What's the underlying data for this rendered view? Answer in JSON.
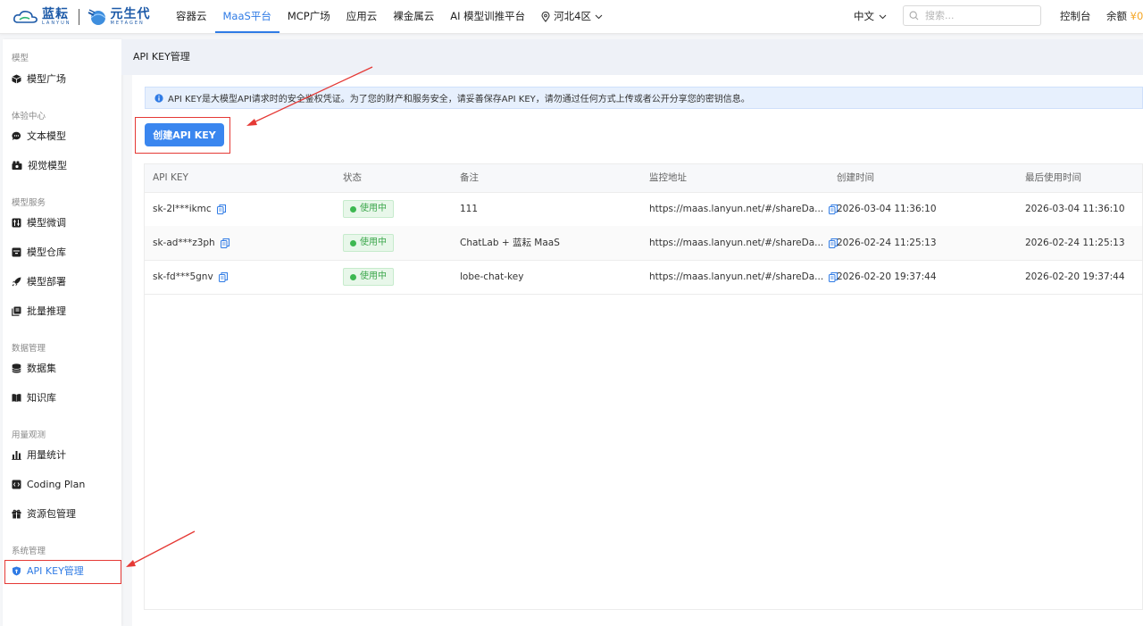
{
  "header": {
    "logo1_text": "蓝耘",
    "logo1_sub": "LANYUN",
    "logo2_text": "元生代",
    "logo2_sub": "METAGEN",
    "nav": [
      "容器云",
      "MaaS平台",
      "MCP广场",
      "应用云",
      "裸金属云",
      "AI 模型训推平台"
    ],
    "active_nav": "MaaS平台",
    "region": "河北4区",
    "language": "中文",
    "search_placeholder": "搜索...",
    "console": "控制台",
    "balance_label": "余额",
    "balance_value": "¥0"
  },
  "sidebar": {
    "sections": [
      {
        "title": "模型",
        "items": [
          {
            "label": "模型广场",
            "icon": "cube-icon"
          }
        ]
      },
      {
        "title": "体验中心",
        "items": [
          {
            "label": "文本模型",
            "icon": "chat-bubble-icon"
          },
          {
            "label": "视觉模型",
            "icon": "vision-icon"
          }
        ]
      },
      {
        "title": "模型服务",
        "items": [
          {
            "label": "模型微调",
            "icon": "tune-icon"
          },
          {
            "label": "模型仓库",
            "icon": "archive-icon"
          },
          {
            "label": "模型部署",
            "icon": "rocket-icon"
          },
          {
            "label": "批量推理",
            "icon": "batch-icon"
          }
        ]
      },
      {
        "title": "数据管理",
        "items": [
          {
            "label": "数据集",
            "icon": "database-icon"
          },
          {
            "label": "知识库",
            "icon": "book-icon"
          }
        ]
      },
      {
        "title": "用量观测",
        "items": [
          {
            "label": "用量统计",
            "icon": "bar-chart-icon"
          },
          {
            "label": "Coding Plan",
            "icon": "code-icon"
          },
          {
            "label": "资源包管理",
            "icon": "gift-icon"
          }
        ]
      },
      {
        "title": "系统管理",
        "items": [
          {
            "label": "API KEY管理",
            "icon": "shield-icon"
          }
        ]
      }
    ],
    "active_item": "API KEY管理"
  },
  "page": {
    "title": "API KEY管理",
    "info": "API KEY是大模型API请求时的安全鉴权凭证。为了您的财产和服务安全，请妥善保存API KEY，请勿通过任何方式上传或者公开分享您的密钥信息。",
    "create_button": "创建API KEY"
  },
  "table": {
    "columns": [
      "API KEY",
      "状态",
      "备注",
      "监控地址",
      "创建时间",
      "最后使用时间"
    ],
    "rows": [
      {
        "key": "sk-2l***ikmc",
        "status": "使用中",
        "note": "111",
        "monitor": "https://maas.lanyun.net/#/shareDa...",
        "created": "2026-03-04 11:36:10",
        "last_used": "2026-03-04 11:36:10"
      },
      {
        "key": "sk-ad***z3ph",
        "status": "使用中",
        "note": "ChatLab + 蓝耘 MaaS",
        "monitor": "https://maas.lanyun.net/#/shareDa...",
        "created": "2026-02-24 11:25:13",
        "last_used": "2026-02-24 11:25:13"
      },
      {
        "key": "sk-fd***5gnv",
        "status": "使用中",
        "note": "lobe-chat-key",
        "monitor": "https://maas.lanyun.net/#/shareDa...",
        "created": "2026-02-20 19:37:44",
        "last_used": "2026-02-20 19:37:44"
      }
    ]
  },
  "colors": {
    "accent": "#2f7be5",
    "annotation_red": "#e53935",
    "status_green": "#3aa64a",
    "balance_orange": "#f5a623"
  }
}
